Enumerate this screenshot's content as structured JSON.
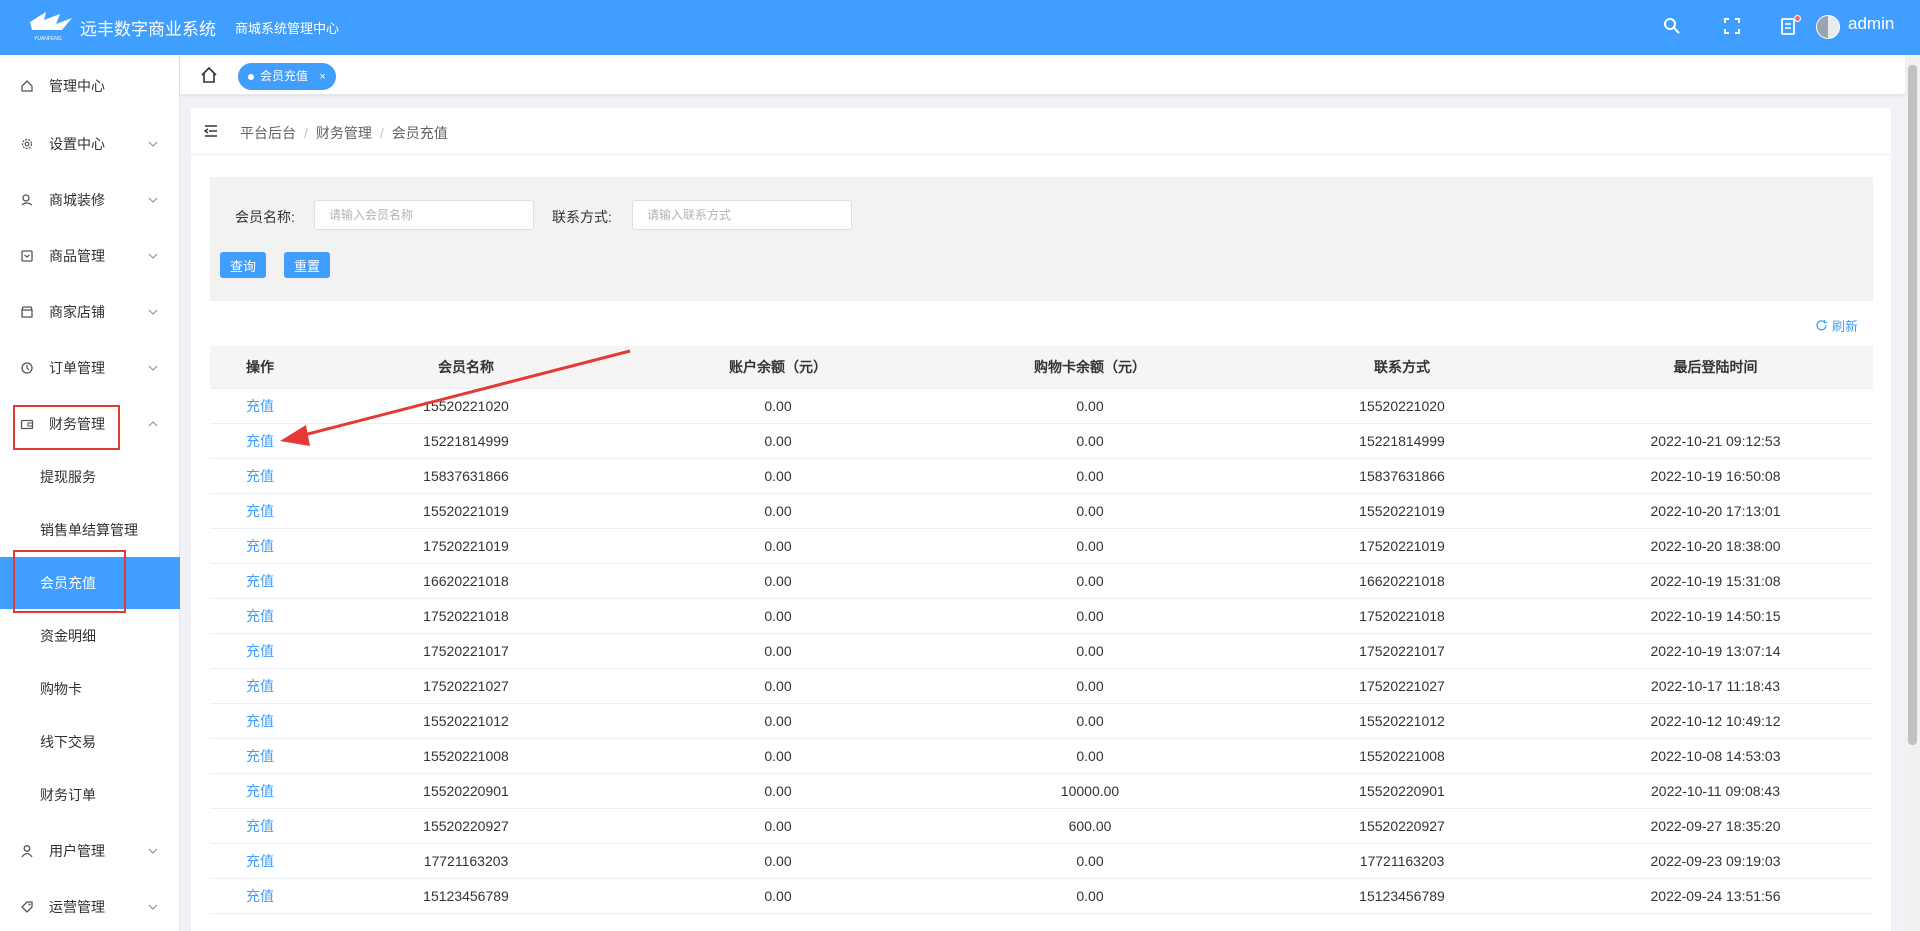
{
  "header": {
    "app_title": "远丰数字商业系统",
    "logo_text": "YUANFENG",
    "subtitle": "商城系统管理中心",
    "user": "admin"
  },
  "sidebar": {
    "items": [
      {
        "label": "管理中心",
        "icon": "home-icon"
      },
      {
        "label": "设置中心",
        "icon": "gear-icon"
      },
      {
        "label": "商城装修",
        "icon": "decoration-icon"
      },
      {
        "label": "商品管理",
        "icon": "goods-icon"
      },
      {
        "label": "商家店铺",
        "icon": "store-icon"
      },
      {
        "label": "订单管理",
        "icon": "order-icon"
      },
      {
        "label": "财务管理",
        "icon": "wallet-icon"
      },
      {
        "label": "用户管理",
        "icon": "user-icon"
      },
      {
        "label": "运营管理",
        "icon": "tag-icon"
      }
    ],
    "finance_sub": [
      {
        "label": "提现服务"
      },
      {
        "label": "销售单结算管理"
      },
      {
        "label": "会员充值",
        "active": true
      },
      {
        "label": "资金明细"
      },
      {
        "label": "购物卡"
      },
      {
        "label": "线下交易"
      },
      {
        "label": "财务订单"
      }
    ]
  },
  "tabs": {
    "active_label": "会员充值",
    "close": "×"
  },
  "breadcrumb": [
    "平台后台",
    "财务管理",
    "会员充值"
  ],
  "breadcrumb_sep": "/",
  "search": {
    "name_label": "会员名称:",
    "name_placeholder": "请输入会员名称",
    "contact_label": "联系方式:",
    "contact_placeholder": "请输入联系方式",
    "query_btn": "查询",
    "reset_btn": "重置"
  },
  "refresh_label": "刷新",
  "table": {
    "headers": [
      "操作",
      "会员名称",
      "账户余额（元）",
      "购物卡余额（元）",
      "联系方式",
      "最后登陆时间"
    ],
    "rows": [
      {
        "action": "充值",
        "name": "15520221020",
        "balance": "0.00",
        "card": "0.00",
        "contact": "15520221020",
        "last": ""
      },
      {
        "action": "充值",
        "name": "15221814999",
        "balance": "0.00",
        "card": "0.00",
        "contact": "15221814999",
        "last": "2022-10-21 09:12:53"
      },
      {
        "action": "充值",
        "name": "15837631866",
        "balance": "0.00",
        "card": "0.00",
        "contact": "15837631866",
        "last": "2022-10-19 16:50:08"
      },
      {
        "action": "充值",
        "name": "15520221019",
        "balance": "0.00",
        "card": "0.00",
        "contact": "15520221019",
        "last": "2022-10-20 17:13:01"
      },
      {
        "action": "充值",
        "name": "17520221019",
        "balance": "0.00",
        "card": "0.00",
        "contact": "17520221019",
        "last": "2022-10-20 18:38:00"
      },
      {
        "action": "充值",
        "name": "16620221018",
        "balance": "0.00",
        "card": "0.00",
        "contact": "16620221018",
        "last": "2022-10-19 15:31:08"
      },
      {
        "action": "充值",
        "name": "17520221018",
        "balance": "0.00",
        "card": "0.00",
        "contact": "17520221018",
        "last": "2022-10-19 14:50:15"
      },
      {
        "action": "充值",
        "name": "17520221017",
        "balance": "0.00",
        "card": "0.00",
        "contact": "17520221017",
        "last": "2022-10-19 13:07:14"
      },
      {
        "action": "充值",
        "name": "17520221027",
        "balance": "0.00",
        "card": "0.00",
        "contact": "17520221027",
        "last": "2022-10-17 11:18:43"
      },
      {
        "action": "充值",
        "name": "15520221012",
        "balance": "0.00",
        "card": "0.00",
        "contact": "15520221012",
        "last": "2022-10-12 10:49:12"
      },
      {
        "action": "充值",
        "name": "15520221008",
        "balance": "0.00",
        "card": "0.00",
        "contact": "15520221008",
        "last": "2022-10-08 14:53:03"
      },
      {
        "action": "充值",
        "name": "15520220901",
        "balance": "0.00",
        "card": "10000.00",
        "contact": "15520220901",
        "last": "2022-10-11 09:08:43"
      },
      {
        "action": "充值",
        "name": "15520220927",
        "balance": "0.00",
        "card": "600.00",
        "contact": "15520220927",
        "last": "2022-09-27 18:35:20"
      },
      {
        "action": "充值",
        "name": "17721163203",
        "balance": "0.00",
        "card": "0.00",
        "contact": "17721163203",
        "last": "2022-09-23 09:19:03"
      },
      {
        "action": "充值",
        "name": "15123456789",
        "balance": "0.00",
        "card": "0.00",
        "contact": "15123456789",
        "last": "2022-09-24 13:51:56"
      }
    ]
  },
  "colors": {
    "primary": "#409eff",
    "annotation": "#e53935"
  }
}
